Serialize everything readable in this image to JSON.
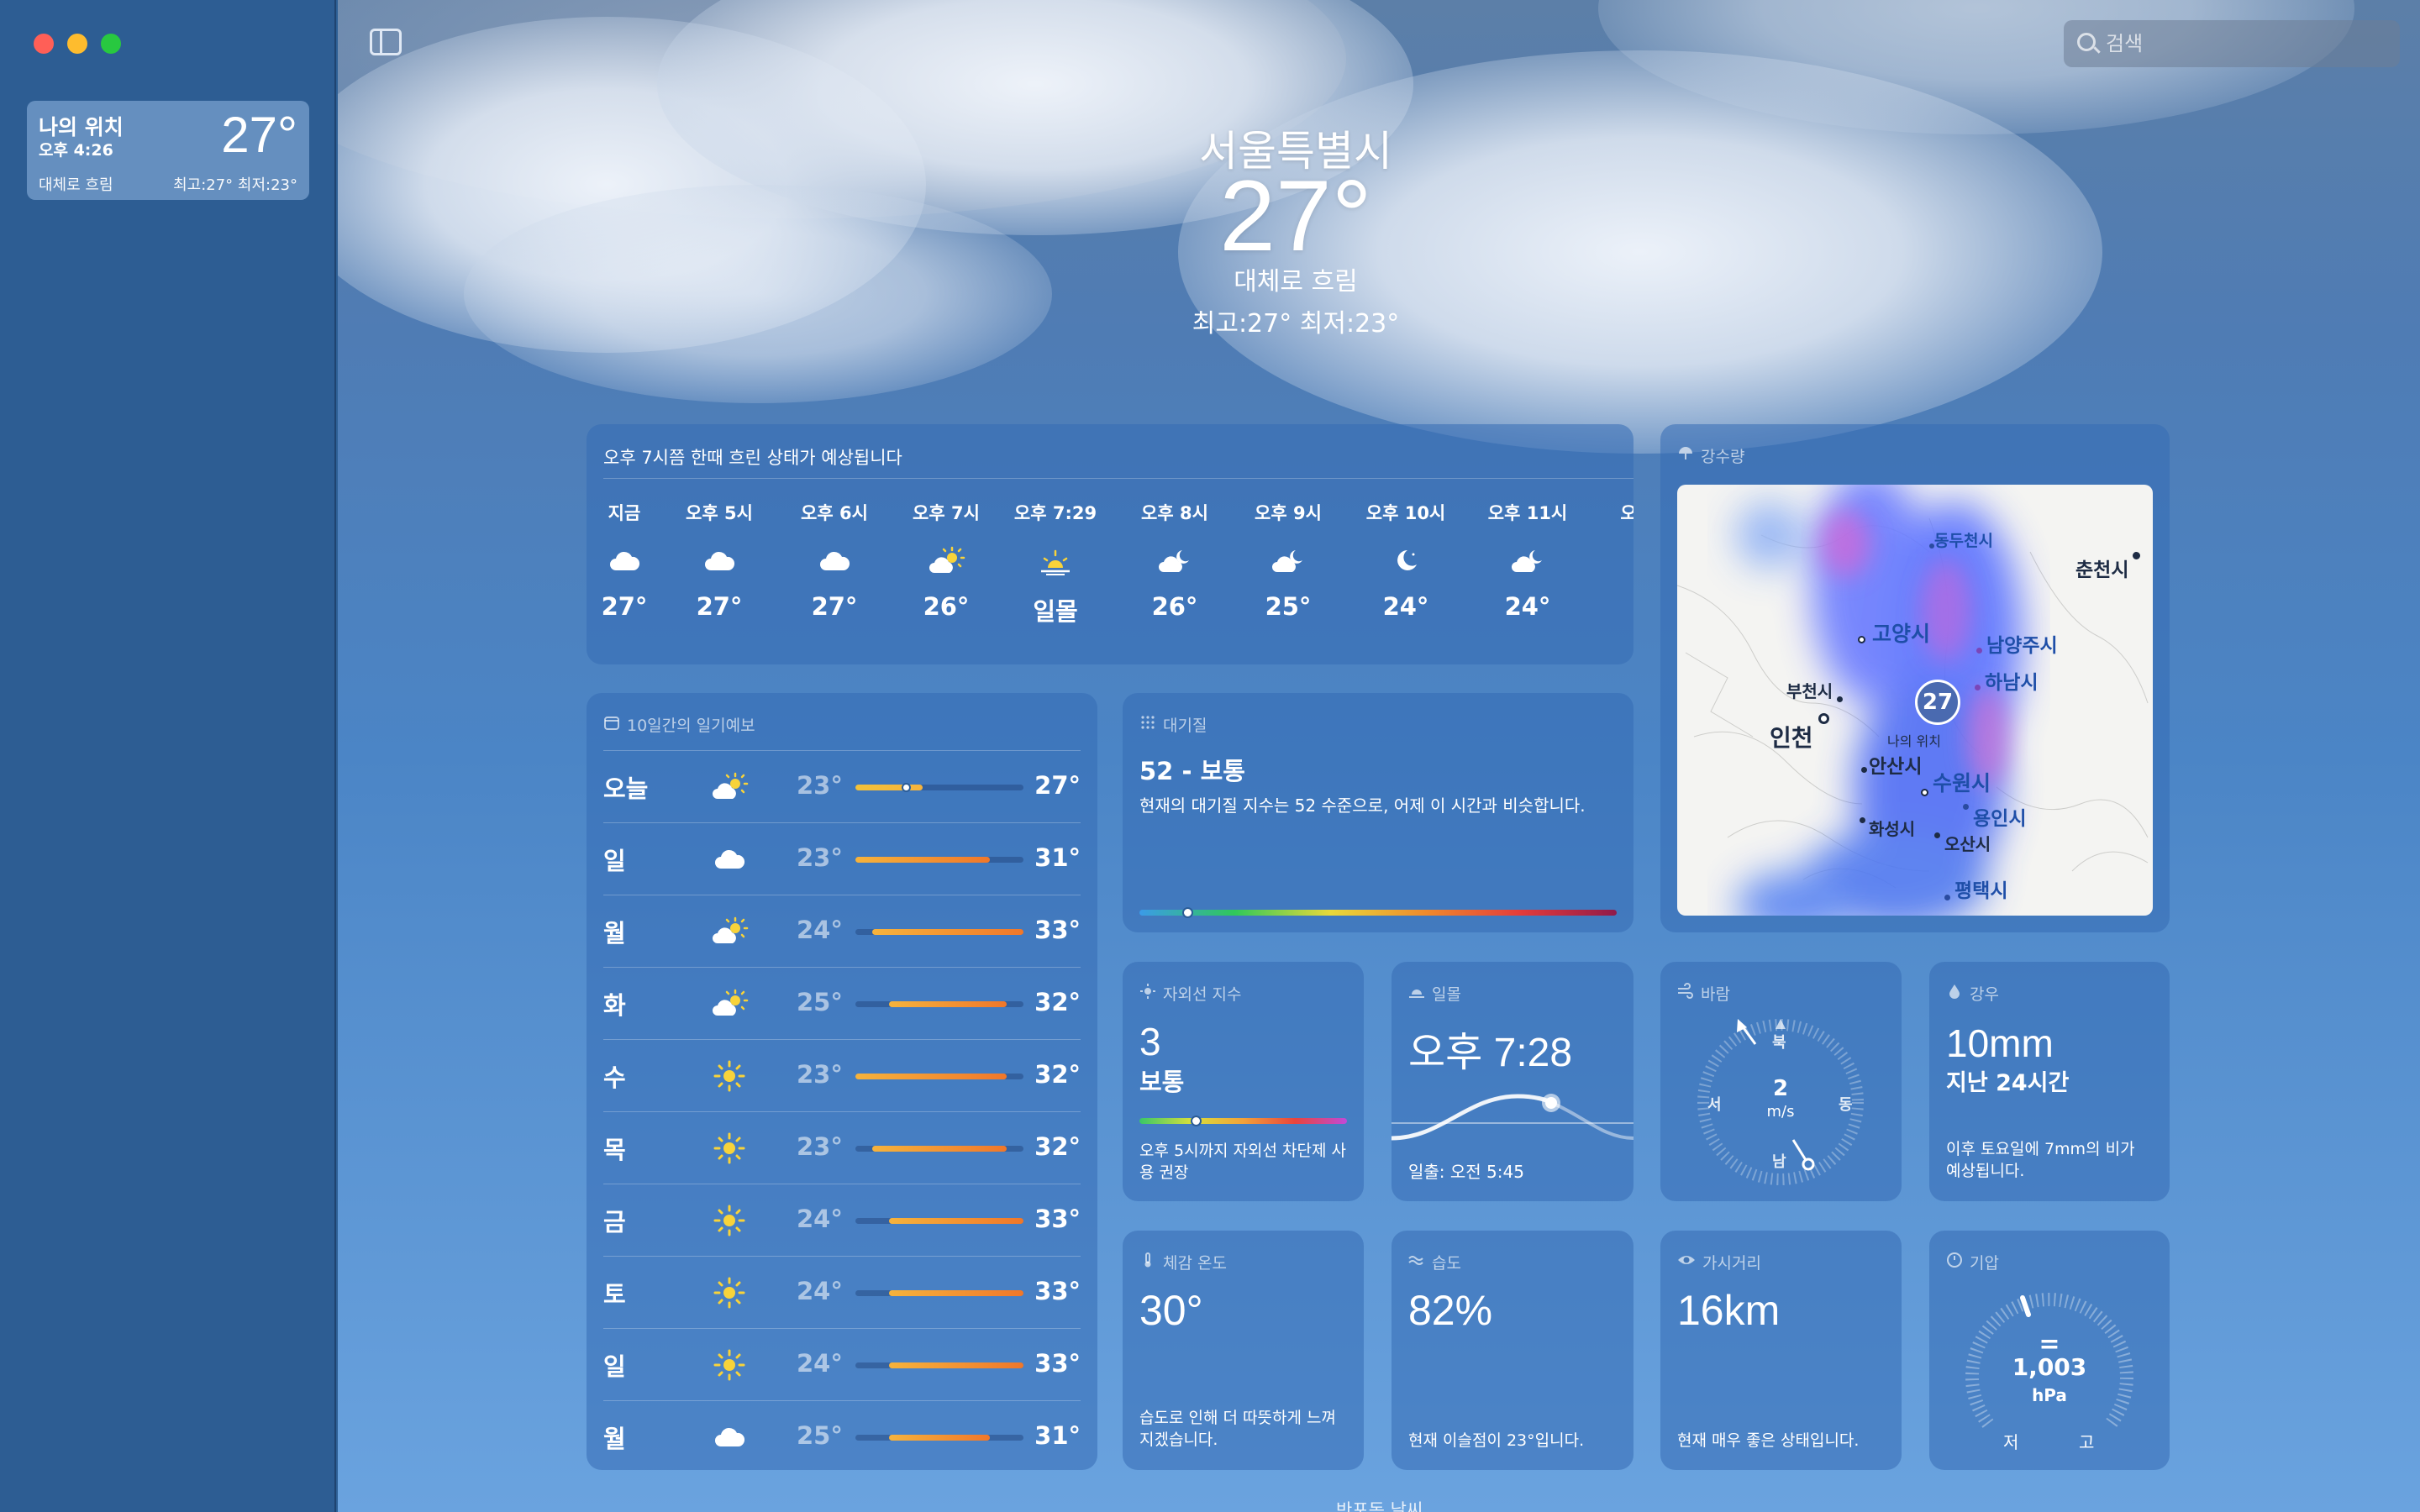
{
  "window": {
    "colors": {
      "close": "#ff5f57",
      "minimize": "#febc2e",
      "maximize": "#28c840"
    }
  },
  "sidebar": {
    "location": {
      "name": "나의 위치",
      "time": "오후 4:26",
      "temp": "27°",
      "condition": "대체로 흐림",
      "high_low": "최고:27°  최저:23°"
    }
  },
  "search": {
    "placeholder": "검색"
  },
  "current": {
    "city": "서울특별시",
    "temp": "27°",
    "condition": "대체로 흐림",
    "high_low": "최고:27°  최저:23°"
  },
  "hourly": {
    "summary": "오후 7시쯤 한때 흐린 상태가 예상됩니다",
    "items": [
      {
        "time": "지금",
        "icon": "cloud-icon",
        "value": "27°"
      },
      {
        "time": "오후 5시",
        "icon": "cloud-icon",
        "value": "27°"
      },
      {
        "time": "오후 6시",
        "icon": "cloud-icon",
        "value": "27°"
      },
      {
        "time": "오후 7시",
        "icon": "partly-sunny-icon",
        "value": "26°"
      },
      {
        "time": "오후 7:29",
        "icon": "sunset-icon",
        "value": "일몰"
      },
      {
        "time": "오후 8시",
        "icon": "partly-cloudy-night-icon",
        "value": "26°"
      },
      {
        "time": "오후 9시",
        "icon": "partly-cloudy-night-icon",
        "value": "25°"
      },
      {
        "time": "오후 10시",
        "icon": "moon-icon",
        "value": "24°"
      },
      {
        "time": "오후 11시",
        "icon": "partly-cloudy-night-icon",
        "value": "24°"
      },
      {
        "time": "오",
        "icon": "",
        "value": ""
      }
    ]
  },
  "daily": {
    "title": "10일간의 일기예보",
    "range": [
      23,
      33
    ],
    "items": [
      {
        "day": "오늘",
        "icon": "partly-sunny-icon",
        "low": "23°",
        "high": "27°",
        "lo": 23,
        "hi": 27,
        "current": 26
      },
      {
        "day": "일",
        "icon": "cloud-icon",
        "low": "23°",
        "high": "31°",
        "lo": 23,
        "hi": 31
      },
      {
        "day": "월",
        "icon": "partly-sunny-icon",
        "low": "24°",
        "high": "33°",
        "lo": 24,
        "hi": 33
      },
      {
        "day": "화",
        "icon": "partly-sunny-icon",
        "low": "25°",
        "high": "32°",
        "lo": 25,
        "hi": 32
      },
      {
        "day": "수",
        "icon": "sun-icon",
        "low": "23°",
        "high": "32°",
        "lo": 23,
        "hi": 32
      },
      {
        "day": "목",
        "icon": "sun-icon",
        "low": "23°",
        "high": "32°",
        "lo": 24,
        "hi": 32
      },
      {
        "day": "금",
        "icon": "sun-icon",
        "low": "24°",
        "high": "33°",
        "lo": 25,
        "hi": 33
      },
      {
        "day": "토",
        "icon": "sun-icon",
        "low": "24°",
        "high": "33°",
        "lo": 25,
        "hi": 33
      },
      {
        "day": "일",
        "icon": "sun-icon",
        "low": "24°",
        "high": "33°",
        "lo": 25,
        "hi": 33
      },
      {
        "day": "월",
        "icon": "cloud-icon",
        "low": "25°",
        "high": "31°",
        "lo": 25,
        "hi": 31
      }
    ]
  },
  "air_quality": {
    "title": "대기질",
    "value": "52 - 보통",
    "desc": "현재의 대기질 지수는 52 수준으로, 어제 이 시간과 비슷합니다.",
    "indicator": 0.1
  },
  "precip_map": {
    "title": "강수량",
    "my_location_temp": "27",
    "my_location_label": "나의 위치",
    "places": [
      "동두천시",
      "춘천시",
      "고양시",
      "남양주시",
      "하남시",
      "부천시",
      "인천",
      "안산시",
      "수원시",
      "용인시",
      "화성시",
      "오산시",
      "평택시"
    ]
  },
  "uv": {
    "title": "자외선 지수",
    "value": "3",
    "level": "보통",
    "desc": "오후 5시까지 자외선 차단제 사용 권장",
    "indicator": 0.27
  },
  "sunset": {
    "title": "일몰",
    "value": "오후 7:28",
    "sunrise": "일출: 오전 5:45"
  },
  "wind": {
    "title": "바람",
    "speed": "2",
    "unit": "m/s",
    "n": "북",
    "e": "동",
    "s": "남",
    "w": "서"
  },
  "rain": {
    "title": "강우",
    "value": "10mm",
    "period": "지난 24시간",
    "desc": "이후 토요일에 7mm의 비가 예상됩니다."
  },
  "feels_like": {
    "title": "체감 온도",
    "value": "30°",
    "desc": "습도로 인해 더 따뜻하게 느껴지겠습니다."
  },
  "humidity": {
    "title": "습도",
    "value": "82%",
    "desc": "현재 이슬점이 23°입니다."
  },
  "visibility": {
    "title": "가시거리",
    "value": "16km",
    "desc": "현재 매우 좋은 상태입니다."
  },
  "pressure": {
    "title": "기압",
    "symbol": "=",
    "value": "1,003",
    "unit": "hPa",
    "low": "저",
    "high": "고"
  },
  "footer": {
    "text": "반포동 날씨"
  }
}
